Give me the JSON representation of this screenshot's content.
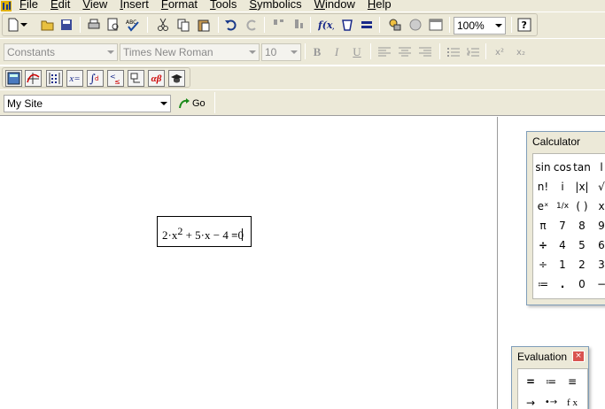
{
  "menu": [
    "File",
    "Edit",
    "View",
    "Insert",
    "Format",
    "Tools",
    "Symbolics",
    "Window",
    "Help"
  ],
  "toolbar": {
    "zoom": "100%"
  },
  "format_bar": {
    "style": "Constants",
    "font": "Times New Roman",
    "size": "10",
    "bold": "B",
    "italic": "I",
    "underline": "U",
    "superscript": "x²",
    "subscript": "x₂"
  },
  "math_bar": {
    "eval_label": "x=",
    "greek_label": "αβ"
  },
  "resources_bar": {
    "site": "My Site",
    "go": "Go"
  },
  "worksheet": {
    "expr_pre": "2·x",
    "expr_exp": "2",
    "expr_post": " + 5·x − 4 ",
    "eq": "=",
    "result": "0"
  },
  "calculator": {
    "title": "Calculator",
    "rows": [
      [
        "sin",
        "cos",
        "tan",
        "l"
      ],
      [
        "n!",
        "i",
        "|x|",
        "√"
      ],
      [
        "eˣ",
        "1/x",
        "( )",
        "x"
      ],
      [
        "π",
        "7",
        "8",
        "9"
      ],
      [
        "÷",
        "4",
        "5",
        "6"
      ],
      [
        "÷",
        "1",
        "2",
        "3"
      ],
      [
        "≔",
        ".",
        "0",
        "−"
      ]
    ]
  },
  "evaluation": {
    "title": "Evaluation",
    "close": "×",
    "rows": [
      [
        "=",
        "≔",
        "≡"
      ],
      [
        "→",
        "•→",
        "f x"
      ]
    ]
  }
}
